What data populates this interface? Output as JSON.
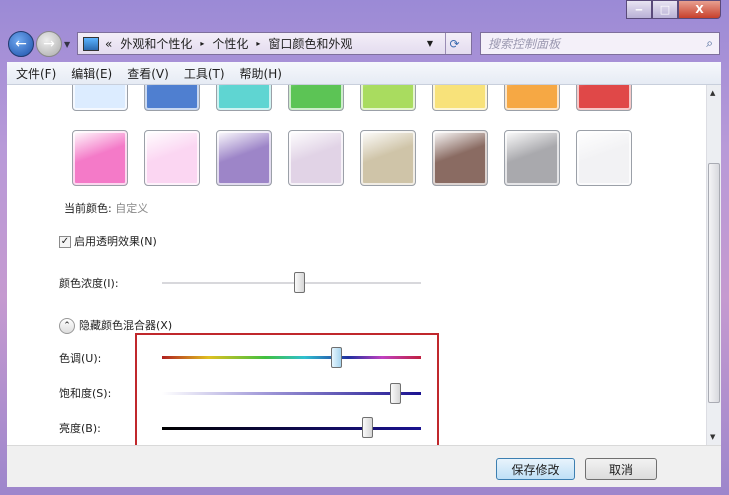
{
  "window": {
    "minimize": "‒",
    "maximize": "□",
    "close": "X"
  },
  "address": {
    "prefix": "«",
    "crumbs": [
      "外观和个性化",
      "个性化",
      "窗口颜色和外观"
    ],
    "separator": "▸"
  },
  "search": {
    "placeholder": "搜索控制面板"
  },
  "menu": [
    "文件(F)",
    "编辑(E)",
    "查看(V)",
    "工具(T)",
    "帮助(H)"
  ],
  "swatches_row1": [
    "#dcecff",
    "#4f7fd0",
    "#5fd5d2",
    "#5cc455",
    "#a9dc5f",
    "#f8e27a",
    "#f6a844",
    "#e04848"
  ],
  "swatches_row2": [
    "#f47ac8",
    "#fbd6f2",
    "#9d85c8",
    "#e1d3e6",
    "#cfc4a8",
    "#8a6b62",
    "#a9a9ad",
    "#f2f2f4"
  ],
  "current_color": {
    "label": "当前颜色:",
    "value": "自定义"
  },
  "transparency": {
    "label": "启用透明效果(N)",
    "checked": true
  },
  "intensity": {
    "label": "颜色浓度(I):",
    "value": 0.53
  },
  "mixer_toggle": "隐藏颜色混合器(X)",
  "hue": {
    "label": "色调(U):",
    "value": 0.67
  },
  "saturation": {
    "label": "饱和度(S):",
    "value": 0.9
  },
  "brightness": {
    "label": "亮度(B):",
    "value": 0.79
  },
  "buttons": {
    "save": "保存修改",
    "cancel": "取消"
  }
}
